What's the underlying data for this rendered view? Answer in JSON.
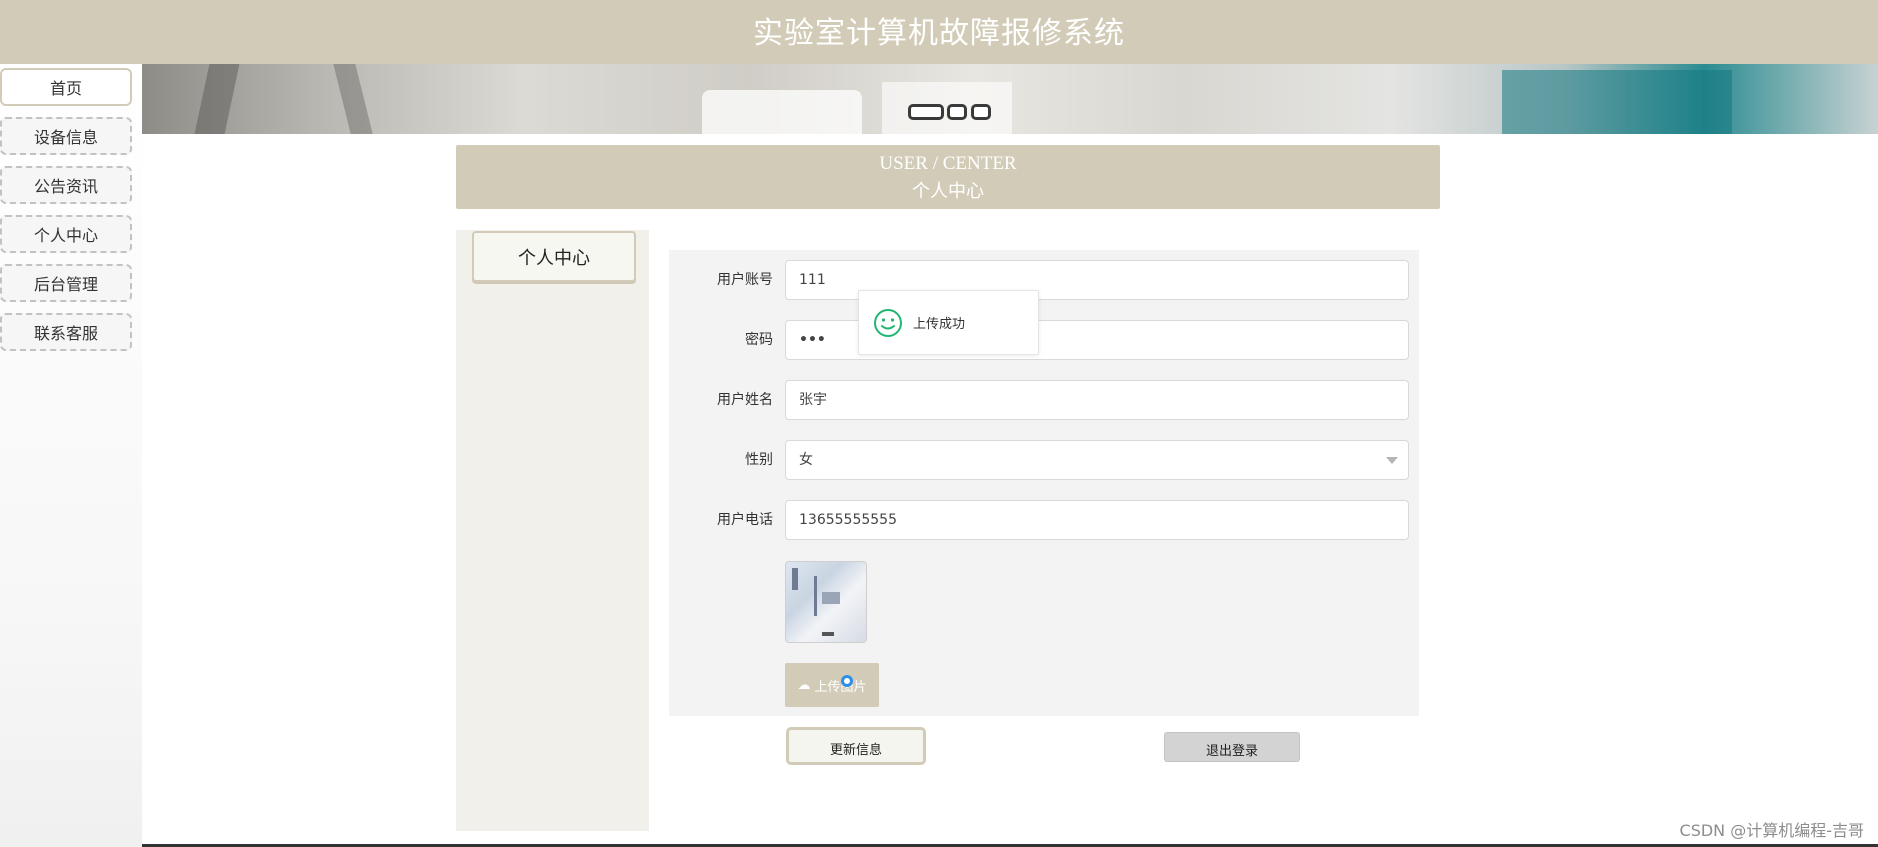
{
  "header": {
    "title": "实验室计算机故障报修系统"
  },
  "sidebar": {
    "items": [
      {
        "label": "首页",
        "active": true
      },
      {
        "label": "设备信息"
      },
      {
        "label": "公告资讯"
      },
      {
        "label": "个人中心"
      },
      {
        "label": "后台管理"
      },
      {
        "label": "联系客服"
      }
    ]
  },
  "banner": {
    "slides": 3,
    "active_slide": 1
  },
  "section": {
    "title_en": "USER / CENTER",
    "title_cn": "个人中心"
  },
  "left_menu": {
    "tab_label": "个人中心"
  },
  "form": {
    "account": {
      "label": "用户账号",
      "value": "111"
    },
    "password": {
      "label": "密码",
      "value": "•••"
    },
    "name": {
      "label": "用户姓名",
      "value": "张宇"
    },
    "gender": {
      "label": "性别",
      "value": "女"
    },
    "phone": {
      "label": "用户电话",
      "value": "13655555555"
    },
    "upload_label": "上传图片",
    "update_label": "更新信息",
    "logout_label": "退出登录"
  },
  "toast": {
    "message": "上传成功"
  },
  "watermark": {
    "text": "CSDN @计算机编程-吉哥"
  },
  "colors": {
    "accent": "#d2cbb7",
    "panel": "#f3f3f3",
    "left_panel": "#f1f0ea",
    "success": "#22b573",
    "progress": "#2f8fe8"
  }
}
